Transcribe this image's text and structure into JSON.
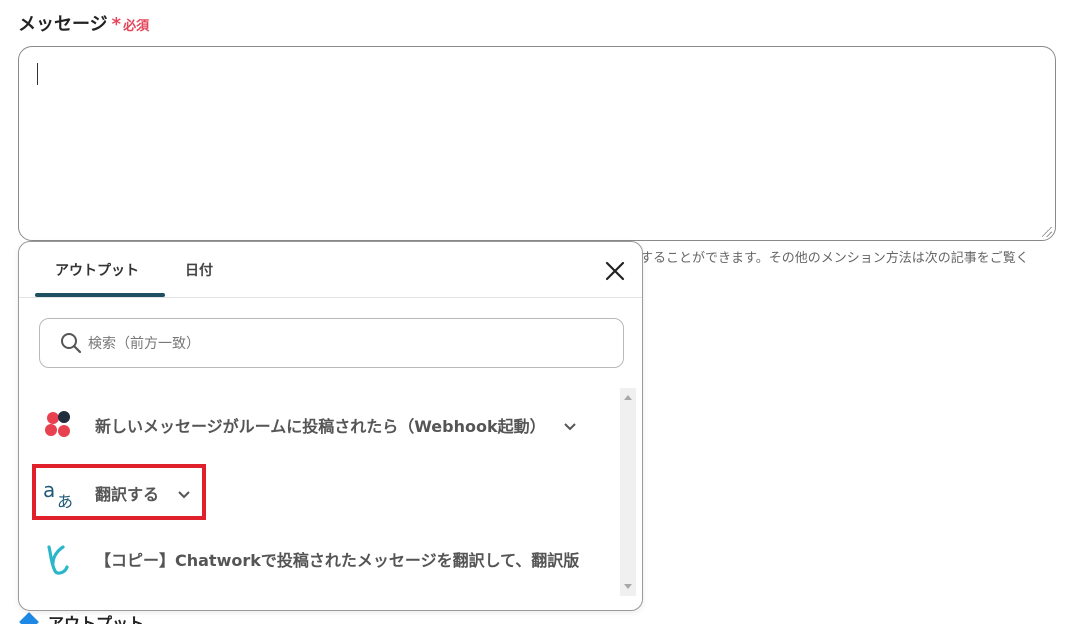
{
  "field": {
    "label": "メッセージ",
    "required_star": "*",
    "required_text": "必須",
    "value": "",
    "hint": "することができます。その他のメンション方法は次の記事をご覧く"
  },
  "popup": {
    "tabs": [
      {
        "label": "アウトプット",
        "active": true
      },
      {
        "label": "日付",
        "active": false
      }
    ],
    "search": {
      "placeholder": "検索（前方一致）",
      "value": ""
    },
    "items": [
      {
        "label": "新しいメッセージがルームに投稿されたら（Webhook起動）",
        "icon": "chatwork-logo-icon",
        "expandable": true
      },
      {
        "label": "翻訳する",
        "icon": "translate-icon",
        "expandable": true,
        "highlighted": true
      },
      {
        "label": "【コピー】Chatworkで投稿されたメッセージを翻訳して、翻訳版",
        "icon": "yoom-logo-icon",
        "expandable": false
      }
    ]
  },
  "section": {
    "output_heading": "アウトプット"
  },
  "colors": {
    "accent": "#1f4f63",
    "required": "#e5465a",
    "highlight": "#e0202a",
    "heading_icon": "#1e88e5"
  }
}
